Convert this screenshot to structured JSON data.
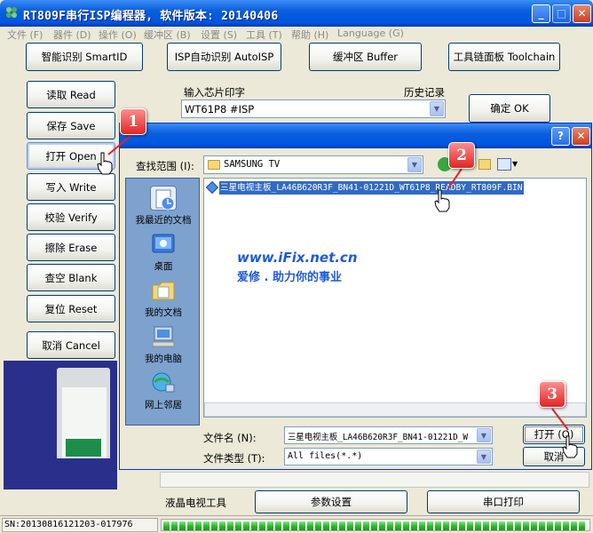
{
  "window": {
    "title": "RT809F串行ISP编程器, 软件版本: 20140406",
    "controls": [
      "_",
      "□",
      "✕"
    ]
  },
  "menu": [
    {
      "label": "文件 (F)"
    },
    {
      "label": "器件 (D)"
    },
    {
      "label": "操作 (O)"
    },
    {
      "label": "缓冲区 (B)"
    },
    {
      "label": "设置 (S)"
    },
    {
      "label": "工具 (T)"
    },
    {
      "label": "帮助 (H)"
    },
    {
      "label": "Language (G)"
    }
  ],
  "toolbar": {
    "smart_id": "智能识别 SmartID",
    "isp_auto": "ISP自动识别 AutoISP",
    "buffer": "缓冲区 Buffer",
    "toolchain": "工具链面板 Toolchain"
  },
  "side_buttons": [
    {
      "label": "读取 Read"
    },
    {
      "label": "保存 Save"
    },
    {
      "label": "打开 Open"
    },
    {
      "label": "写入 Write"
    },
    {
      "label": "校验 Verify"
    },
    {
      "label": "擦除 Erase"
    },
    {
      "label": "查空 Blank"
    },
    {
      "label": "复位 Reset"
    },
    {
      "label": "取消 Cancel"
    }
  ],
  "chip_input": {
    "label": "输入芯片印字",
    "history_label": "历史记录",
    "value": "WT61P8 #ISP",
    "confirm": "确定 OK"
  },
  "bottom": {
    "lcd_tool": "液晶电视工具",
    "params": "参数设置",
    "serial_print": "串口打印"
  },
  "status": {
    "sn": "SN:20130816121203-017976",
    "progress_segments": 53
  },
  "badges": [
    "1",
    "2",
    "3"
  ],
  "dialog": {
    "controls": [
      "?",
      "✕"
    ],
    "look_in_label": "查找范围 (I):",
    "look_in_value": "SAMSUNG TV",
    "places": [
      {
        "label": "我最近的文档",
        "icon": "recent-docs-icon"
      },
      {
        "label": "桌面",
        "icon": "desktop-icon"
      },
      {
        "label": "我的文档",
        "icon": "my-documents-icon"
      },
      {
        "label": "我的电脑",
        "icon": "my-computer-icon"
      },
      {
        "label": "网上邻居",
        "icon": "network-places-icon"
      }
    ],
    "files": [
      {
        "name": "三星电视主板_LA46B620R3F_BN41-01221D_WT61P8_READBY_RT809F.BIN",
        "selected": true
      }
    ],
    "filename_label": "文件名 (N):",
    "filename_value": "三星电视主板_LA46B620R3F_BN41-01221D_W",
    "filetype_label": "文件类型 (T):",
    "filetype_value": "All files(*.*)",
    "open_button": "打开 (O)",
    "cancel_button": "取消"
  },
  "watermark": {
    "url": "www.iFix.net.cn",
    "slogan": "爱修 . 助力你的事业"
  },
  "colors": {
    "xp_blue": "#0054e3",
    "badge_red": "#e02525",
    "selection": "#316ac5",
    "places_bar": "#7da2ce",
    "progress": "#2dbb2d"
  }
}
